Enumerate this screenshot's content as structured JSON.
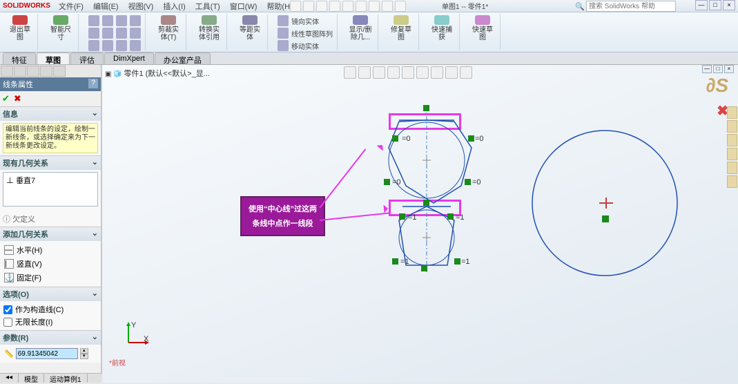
{
  "title": {
    "logo": "SOLIDWORKS",
    "doc": "单图1 -- 零件1*"
  },
  "menu": [
    "文件(F)",
    "编辑(E)",
    "视图(V)",
    "插入(I)",
    "工具(T)",
    "窗口(W)",
    "帮助(H)"
  ],
  "search": {
    "placeholder": "搜索 SolidWorks 帮助"
  },
  "ribbon": {
    "exit_sketch": "退出草图",
    "smart_dim": "智能尺寸",
    "trim": "剪裁实体(T)",
    "convert": "转换实体引用",
    "offset": "等距实体",
    "mirror": "镜向实体",
    "pattern": "线性草图阵列",
    "move": "移动实体",
    "show_hide": "显示/删除几...",
    "repair": "修复草图",
    "quick_snap": "快速捕获",
    "rapid": "快速草图"
  },
  "tabs": [
    "特征",
    "草图",
    "评估",
    "DimXpert",
    "办公室产品"
  ],
  "tabs_active": 1,
  "tree": "零件1 (默认<<默认>_显...",
  "prop": {
    "title": "线条属性",
    "info_head": "信息",
    "info_body": "编辑当前线条的设定，绘制一新线条，或选择确定来为下一新线条更改设定。",
    "relations_head": "现有几何关系",
    "rel_item": "垂直7",
    "under": "欠定义",
    "add_head": "添加几何关系",
    "horiz": "水平(H)",
    "vert": "竖直(V)",
    "fix": "固定(F)",
    "opt_head": "选项(O)",
    "construction": "作为构造线(C)",
    "infinite": "无限长度(I)",
    "param_head": "参数(R)",
    "param_val": "69.91345042"
  },
  "callout": {
    "line1": "使用“中心线”过这两",
    "line2": "条线中点作一线段"
  },
  "bottom": {
    "model": "模型",
    "motion": "运动算例1"
  },
  "status": "*前视",
  "chart_data": null
}
